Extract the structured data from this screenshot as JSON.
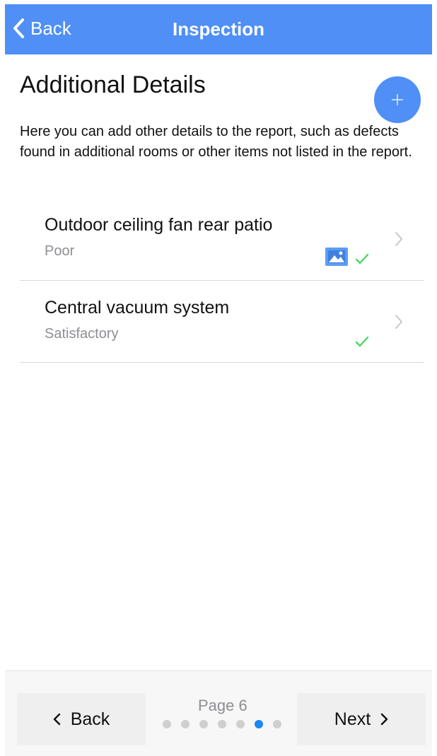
{
  "navbar": {
    "back_label": "Back",
    "title": "Inspection",
    "color": "#4f8ff6"
  },
  "page": {
    "title": "Additional Details",
    "description": "Here you can add other details to the report, such as defects found in additional rooms or other items not listed in the report.",
    "add_button_icon": "plus-icon"
  },
  "items": [
    {
      "name": "Outdoor ceiling fan rear patio",
      "status": "Poor",
      "has_photo": true,
      "completed": true
    },
    {
      "name": "Central vacuum system",
      "status": "Satisfactory",
      "has_photo": false,
      "completed": true
    }
  ],
  "footer": {
    "back_label": "Back",
    "next_label": "Next",
    "page_label": "Page 6",
    "total_pages": 7,
    "current_page": 6,
    "active_dot_color": "#1c86f2"
  }
}
